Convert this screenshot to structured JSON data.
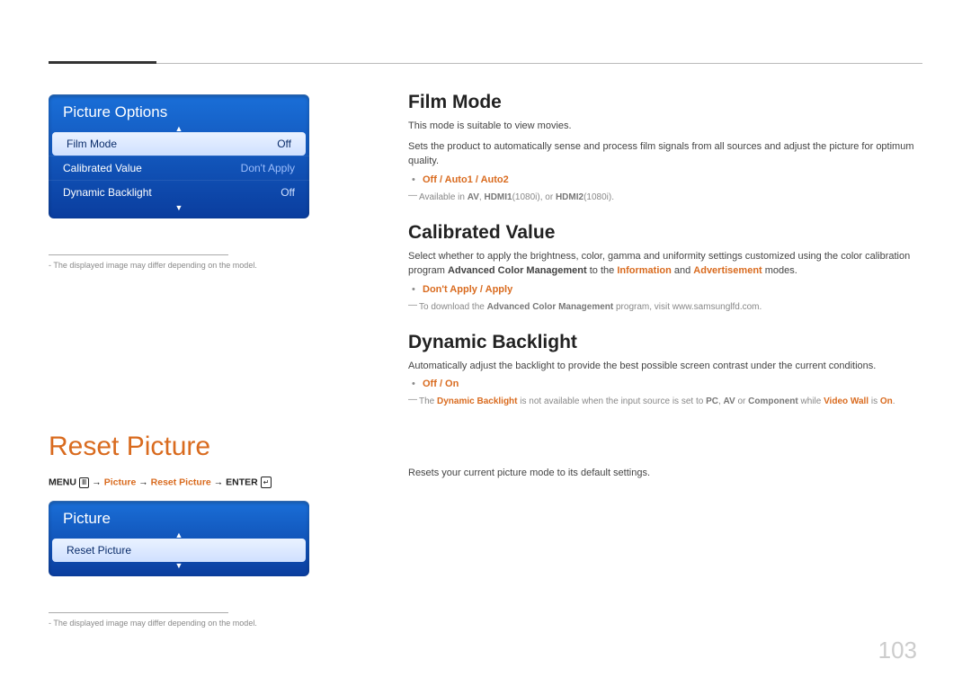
{
  "page_number": "103",
  "left": {
    "panel1": {
      "title": "Picture Options",
      "rows": [
        {
          "label": "Film Mode",
          "value": "Off",
          "highlight": true
        },
        {
          "label": "Calibrated Value",
          "value": "Don't Apply",
          "dimmed": true
        },
        {
          "label": "Dynamic Backlight",
          "value": "Off"
        }
      ]
    },
    "footnote1": "The displayed image may differ depending on the model.",
    "reset_heading": "Reset Picture",
    "menu_path": {
      "menu": "MENU",
      "p1": "Picture",
      "p2": "Reset Picture",
      "enter": "ENTER"
    },
    "panel2": {
      "title": "Picture",
      "rows": [
        {
          "label": "Reset Picture",
          "value": "",
          "highlight": true
        }
      ]
    },
    "footnote2": "The displayed image may differ depending on the model."
  },
  "right": {
    "film_mode": {
      "heading": "Film Mode",
      "p1": "This mode is suitable to view movies.",
      "p2": "Sets the product to automatically sense and process film signals from all sources and adjust the picture for optimum quality.",
      "options": "Off / Auto1 / Auto2",
      "note_pre": "Available in ",
      "note_b1": "AV",
      "note_mid1": ", ",
      "note_b2": "HDMI1",
      "note_mid2": "(1080i), or ",
      "note_b3": "HDMI2",
      "note_end": "(1080i)."
    },
    "calibrated": {
      "heading": "Calibrated Value",
      "p1_a": "Select whether to apply the brightness, color, gamma and uniformity settings customized using the color calibration program ",
      "p1_b": "Advanced Color Management",
      "p1_c": " to the ",
      "p1_d": "Information",
      "p1_e": " and ",
      "p1_f": "Advertisement",
      "p1_g": " modes.",
      "options": "Don't Apply / Apply",
      "note_a": "To download the ",
      "note_b": "Advanced Color Management",
      "note_c": " program, visit www.samsunglfd.com."
    },
    "dynamic": {
      "heading": "Dynamic Backlight",
      "p1": "Automatically adjust the backlight to provide the best possible screen contrast under the current conditions.",
      "options": "Off / On",
      "note_a": "The ",
      "note_b": "Dynamic Backlight",
      "note_c": " is not available when the input source is set to ",
      "note_d": "PC",
      "note_e": ", ",
      "note_f": "AV",
      "note_g": " or ",
      "note_h": "Component",
      "note_i": " while ",
      "note_j": "Video Wall",
      "note_k": " is ",
      "note_l": "On",
      "note_m": "."
    },
    "reset_desc": "Resets your current picture mode to its default settings."
  }
}
